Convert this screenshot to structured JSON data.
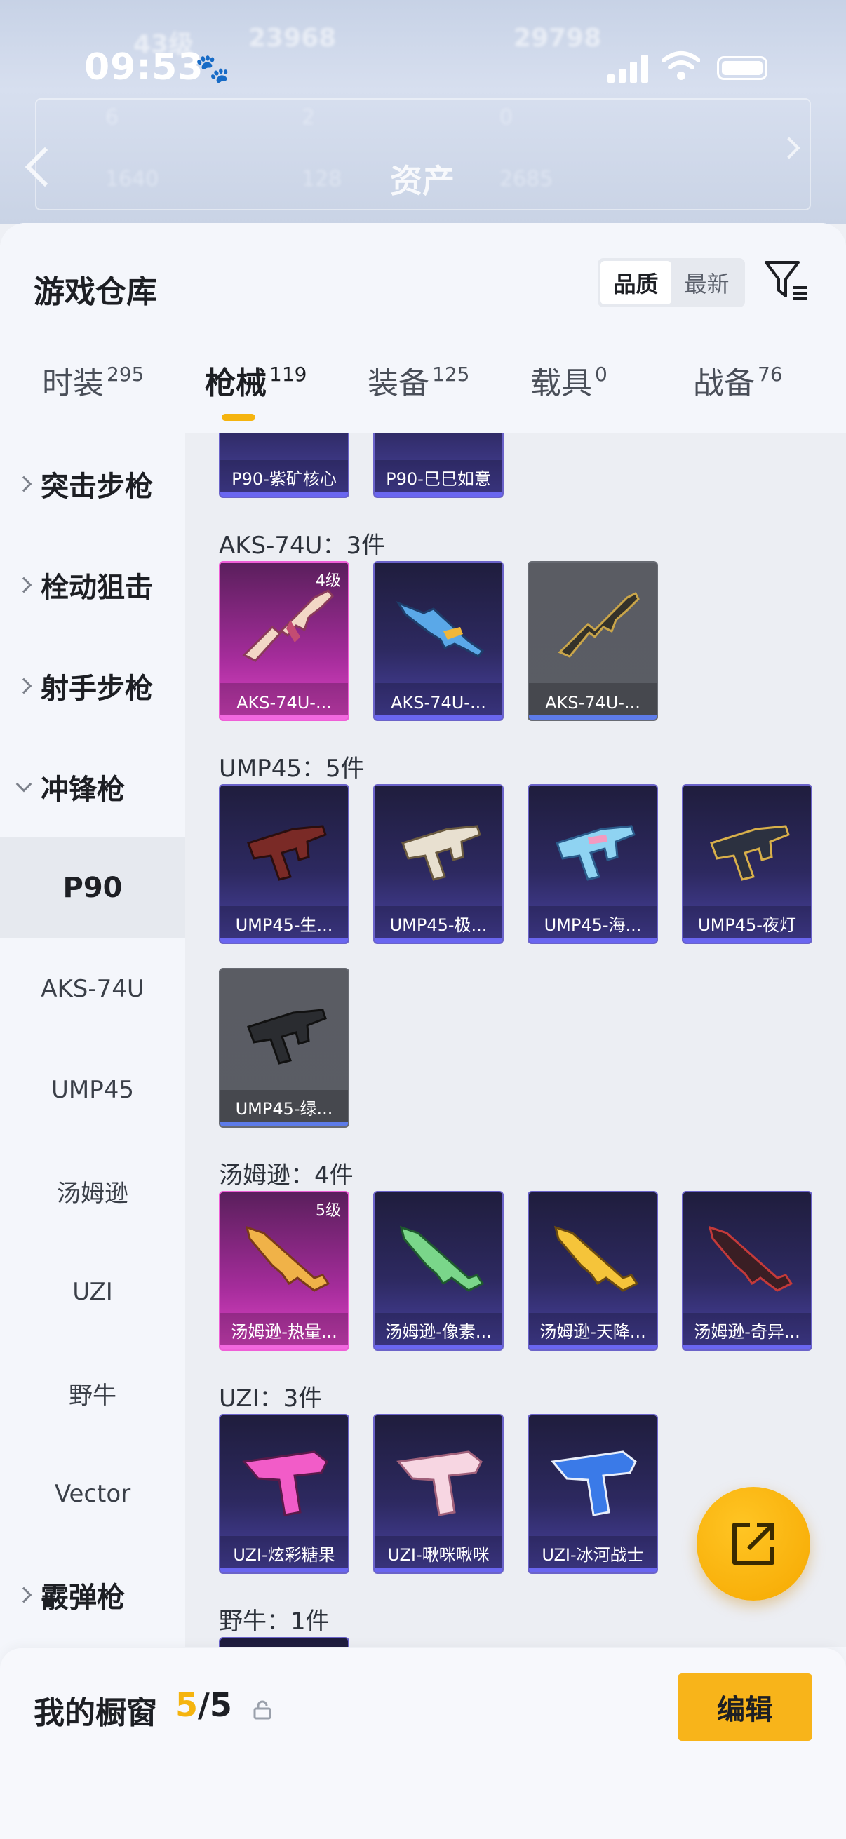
{
  "status_bar": {
    "time": "09:53"
  },
  "background": {
    "title": "资产",
    "stats_row1": [
      "43级",
      "23968",
      "29798"
    ],
    "stats_row2": [
      "6",
      "2",
      "0"
    ],
    "stats_row3": [
      "1640",
      "128",
      "2685"
    ]
  },
  "header": {
    "title": "游戏仓库",
    "sort_quality": "品质",
    "sort_latest": "最新"
  },
  "tabs": [
    {
      "label": "时装",
      "count": "295"
    },
    {
      "label": "枪械",
      "count": "119"
    },
    {
      "label": "装备",
      "count": "125"
    },
    {
      "label": "载具",
      "count": "0"
    },
    {
      "label": "战备",
      "count": "76"
    }
  ],
  "sidebar": {
    "categories": [
      "突击步枪",
      "栓动狙击",
      "射手步枪",
      "冲锋枪",
      "霰弹枪"
    ],
    "submachine": [
      "P90",
      "AKS-74U",
      "UMP45",
      "汤姆逊",
      "UZI",
      "野牛",
      "Vector"
    ]
  },
  "sections": {
    "p90_items": [
      "P90-紫矿核心",
      "P90-巳巳如意"
    ],
    "aks": {
      "title": "AKS-74U：3件",
      "items": [
        {
          "name": "AKS-74U-...",
          "level": "4级"
        },
        {
          "name": "AKS-74U-..."
        },
        {
          "name": "AKS-74U-..."
        }
      ]
    },
    "ump": {
      "title": "UMP45：5件",
      "items": [
        "UMP45-生...",
        "UMP45-极...",
        "UMP45-海...",
        "UMP45-夜灯",
        "UMP45-绿..."
      ]
    },
    "thompson": {
      "title": "汤姆逊：4件",
      "items": [
        {
          "name": "汤姆逊-热量...",
          "level": "5级"
        },
        {
          "name": "汤姆逊-像素..."
        },
        {
          "name": "汤姆逊-天降..."
        },
        {
          "name": "汤姆逊-奇异..."
        }
      ]
    },
    "uzi": {
      "title": "UZI：3件",
      "items": [
        "UZI-炫彩糖果",
        "UZI-啾咪啾咪",
        "UZI-冰河战士"
      ]
    },
    "bison": {
      "title": "野牛：1件"
    }
  },
  "showcase": {
    "title": "我的橱窗",
    "used": "5",
    "total": "/5",
    "edit_label": "编辑"
  },
  "colors": {
    "accent": "#f5b40f",
    "pink_rarity": "#de45c6",
    "purple_rarity": "#4a43a3",
    "gray_rarity": "#5a5c63"
  }
}
